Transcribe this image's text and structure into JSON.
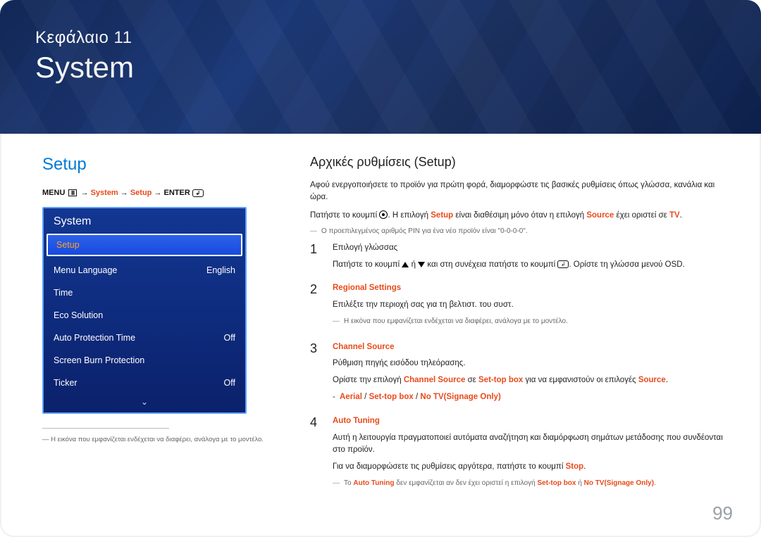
{
  "hero": {
    "chapter_label": "Κεφάλαιο 11",
    "chapter_title": "System"
  },
  "left": {
    "setup_heading": "Setup",
    "breadcrumb": {
      "menu": "MENU",
      "arrow": " → ",
      "system": "System",
      "setup": "Setup",
      "enter": "ENTER"
    },
    "osd": {
      "title": "System",
      "rows": [
        {
          "label": "Setup",
          "value": "",
          "highlight": true
        },
        {
          "label": "Menu Language",
          "value": "English"
        },
        {
          "label": "Time",
          "value": ""
        },
        {
          "label": "Eco Solution",
          "value": ""
        },
        {
          "label": "Auto Protection Time",
          "value": "Off"
        },
        {
          "label": "Screen Burn Protection",
          "value": ""
        },
        {
          "label": "Ticker",
          "value": "Off"
        }
      ]
    },
    "img_note": "Η εικόνα που εμφανίζεται ενδέχεται να διαφέρει, ανάλογα με το μοντέλο."
  },
  "right": {
    "heading": "Αρχικές ρυθμίσεις (Setup)",
    "p1": "Αφού ενεργοποιήσετε το προϊόν για πρώτη φορά, διαμορφώστε τις βασικές ρυθμίσεις όπως γλώσσα, κανάλια και ώρα.",
    "p2_a": "Πατήστε το κουμπί ",
    "p2_b": ". Η επιλογή ",
    "p2_setup": "Setup",
    "p2_c": " είναι διαθέσιμη μόνο όταν η επιλογή ",
    "p2_source": "Source",
    "p2_d": " έχει οριστεί σε ",
    "p2_tv": "TV",
    "p2_e": ".",
    "pin_note": "Ο προεπιλεγμένος αριθμός PIN για ένα νέο προϊόν είναι \"0-0-0-0\".",
    "steps": {
      "s1": {
        "num": "1",
        "title": "Επιλογή γλώσσας",
        "body_a": "Πατήστε το κουμπί ",
        "body_b": " ή ",
        "body_c": " και στη συνέχεια πατήστε το κουμπί ",
        "body_d": ". Ορίστε τη γλώσσα μενού OSD."
      },
      "s2": {
        "num": "2",
        "title": "Regional Settings",
        "body": "Επιλέξτε την περιοχή σας για τη βελτιστ. του συστ.",
        "note": "Η εικόνα που εμφανίζεται ενδέχεται να διαφέρει, ανάλογα με το μοντέλο."
      },
      "s3": {
        "num": "3",
        "title": "Channel Source",
        "body1": "Ρύθμιση πηγής εισόδου τηλεόρασης.",
        "body2_a": "Ορίστε την επιλογή ",
        "body2_cs": "Channel Source",
        "body2_b": " σε ",
        "body2_stb": "Set-top box",
        "body2_c": " για να εμφανιστούν οι επιλογές ",
        "body2_src": "Source",
        "body2_d": ".",
        "dash_a": "Aerial",
        "dash_sep1": " / ",
        "dash_b": "Set-top box",
        "dash_sep2": " / ",
        "dash_c": "No TV(Signage Only)"
      },
      "s4": {
        "num": "4",
        "title": "Auto Tuning",
        "body1": "Αυτή η λειτουργία πραγματοποιεί αυτόματα αναζήτηση και διαμόρφωση σημάτων μετάδοσης που συνδέονται στο προϊόν.",
        "body2_a": "Για να διαμορφώσετε τις ρυθμίσεις αργότερα, πατήστε το κουμπί ",
        "body2_stop": "Stop",
        "body2_b": ".",
        "note_a": "Το ",
        "note_at": "Auto Tuning",
        "note_b": " δεν εμφανίζεται αν δεν έχει οριστεί η επιλογή ",
        "note_stb": "Set-top box",
        "note_c": " ή ",
        "note_ntv": "No TV(Signage Only)",
        "note_d": "."
      }
    }
  },
  "page_number": "99"
}
